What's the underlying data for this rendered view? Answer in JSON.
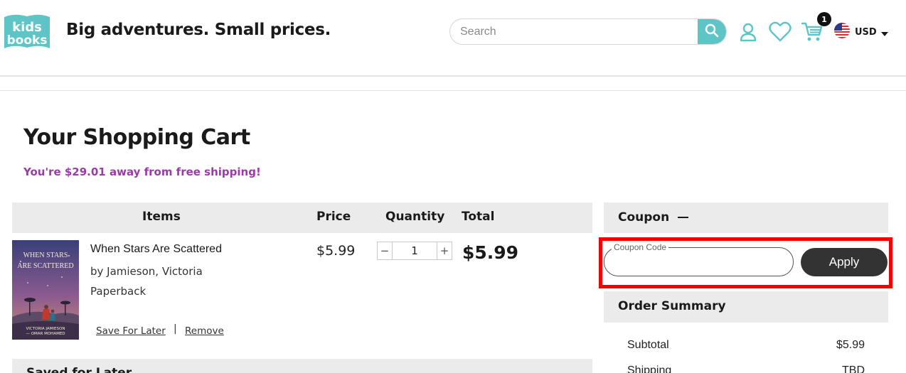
{
  "header": {
    "logo_text_top": "kids",
    "logo_text_bottom": "books",
    "tagline": "Big adventures. Small prices.",
    "search_placeholder": "Search",
    "cart_count": "1",
    "currency": "USD",
    "icons": [
      "search-icon",
      "account-icon",
      "wishlist-heart-icon",
      "cart-icon",
      "us-flag-icon",
      "chevron-down-icon"
    ]
  },
  "page": {
    "title": "Your Shopping Cart",
    "shipping_message": "You're $29.01 away from free shipping!"
  },
  "cart": {
    "columns": [
      "Items",
      "Price",
      "Quantity",
      "Total"
    ],
    "items": [
      {
        "title": "When Stars Are Scattered",
        "author": "by Jamieson, Victoria",
        "format": "Paperback",
        "price": "$5.99",
        "quantity": "1",
        "total": "$5.99",
        "save_label": "Save For Later",
        "separator": "|",
        "remove_label": "Remove",
        "cover_title_line1": "WHEN STARS",
        "cover_title_line2": "ARE SCATTERED",
        "cover_authors_line1": "VICTORIA JAMIESON",
        "cover_authors_line2": "— OMAR MOHAMED"
      }
    ],
    "qty_minus": "−",
    "qty_plus": "+",
    "saved_heading": "Saved for Later"
  },
  "coupon": {
    "heading": "Coupon",
    "field_label": "Coupon Code",
    "field_value": "",
    "apply_label": "Apply"
  },
  "summary": {
    "heading": "Order Summary",
    "rows": [
      {
        "label": "Subtotal",
        "value": "$5.99"
      },
      {
        "label": "Shipping",
        "value": "TBD"
      }
    ]
  },
  "colors": {
    "brand_teal": "#5fc4c6",
    "accent_purple": "#9b3aa8",
    "highlight_red": "#f20000",
    "button_dark": "#333333"
  }
}
